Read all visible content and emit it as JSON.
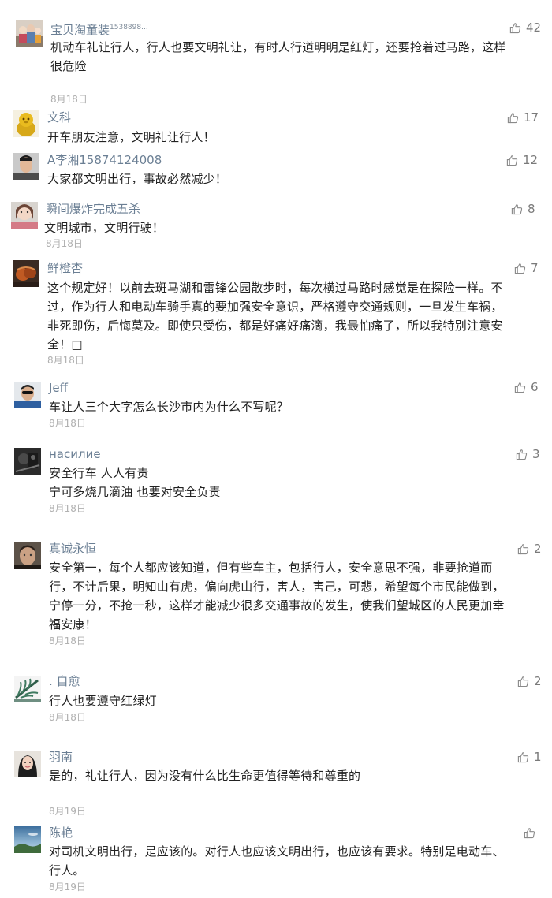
{
  "comments": [
    {
      "name": "宝贝淘童装",
      "name_suffix": "1538898...",
      "lines": [
        "机动车礼让行人，行人也要文明礼让，有时人行道明明是红灯，还要抢着过马路，这样",
        "很危险"
      ],
      "date": "8月18日",
      "likes": "42",
      "avatar": "avatar-group"
    },
    {
      "name": "文科",
      "name_suffix": "",
      "lines": [
        "开车朋友注意，文明礼让行人！"
      ],
      "date": "",
      "likes": "17",
      "avatar": "avatar-gold"
    },
    {
      "name": "A李湘15874124008",
      "name_suffix": "",
      "lines": [
        "大家都文明出行，事故必然减少！"
      ],
      "date": "",
      "likes": "12",
      "avatar": "avatar-man"
    },
    {
      "name": "瞬间爆炸完成五杀",
      "name_suffix": "",
      "lines": [
        "文明城市，文明行驶！"
      ],
      "date": "8月18日",
      "likes": "8",
      "avatar": "avatar-girl"
    },
    {
      "name": "鲜橙杏",
      "name_suffix": "",
      "lines": [
        "这个规定好！以前去斑马湖和雷锋公园散步时，每次横过马路时感觉是在探险一样。不",
        "过，作为行人和电动车骑手真的要加强安全意识，严格遵守交通规则，一旦发生车祸，",
        "非死即伤，后悔莫及。即使只受伤，都是好痛好痛滴，我最怕痛了，所以我特别注意安",
        "全！□"
      ],
      "date": "8月18日",
      "likes": "7",
      "avatar": "avatar-orange"
    },
    {
      "name": "Jeff",
      "name_suffix": "",
      "lines": [
        "车让人三个大字怎么长沙市内为什么不写呢？"
      ],
      "date": "8月18日",
      "likes": "6",
      "avatar": "avatar-jeff"
    },
    {
      "name": "насилие",
      "name_suffix": "",
      "lines": [
        "安全行车 人人有责",
        "宁可多烧几滴油 也要对安全负责"
      ],
      "date": "8月18日",
      "likes": "3",
      "avatar": "avatar-dark"
    },
    {
      "name": "真诚永恒",
      "name_suffix": "",
      "lines": [
        "安全第一，每个人都应该知道，但有些车主，包括行人，安全意思不强，非要抢道而",
        "行，不计后果，明知山有虎，偏向虎山行，害人，害己，可悲，希望每个市民能做到，",
        "宁停一分，不抢一秒，这样才能减少很多交通事故的发生，使我们望城区的人民更加幸",
        "福安康！"
      ],
      "date": "8月18日",
      "likes": "2",
      "avatar": "avatar-face"
    },
    {
      "name": ". 自愈",
      "name_suffix": "",
      "lines": [
        "行人也要遵守红绿灯"
      ],
      "date": "8月18日",
      "likes": "2",
      "avatar": "avatar-leaf"
    },
    {
      "name": "羽南",
      "name_suffix": "",
      "lines": [
        "是的，礼让行人，因为没有什么比生命更值得等待和尊重的"
      ],
      "date": "8月19日",
      "likes": "1",
      "avatar": "avatar-woman"
    },
    {
      "name": "陈艳",
      "name_suffix": "",
      "lines": [
        "对司机文明出行，是应该的。对行人也应该文明出行，也应该有要求。特别是电动车、",
        "行人。"
      ],
      "date": "8月19日",
      "likes": "",
      "avatar": "avatar-sky"
    }
  ]
}
